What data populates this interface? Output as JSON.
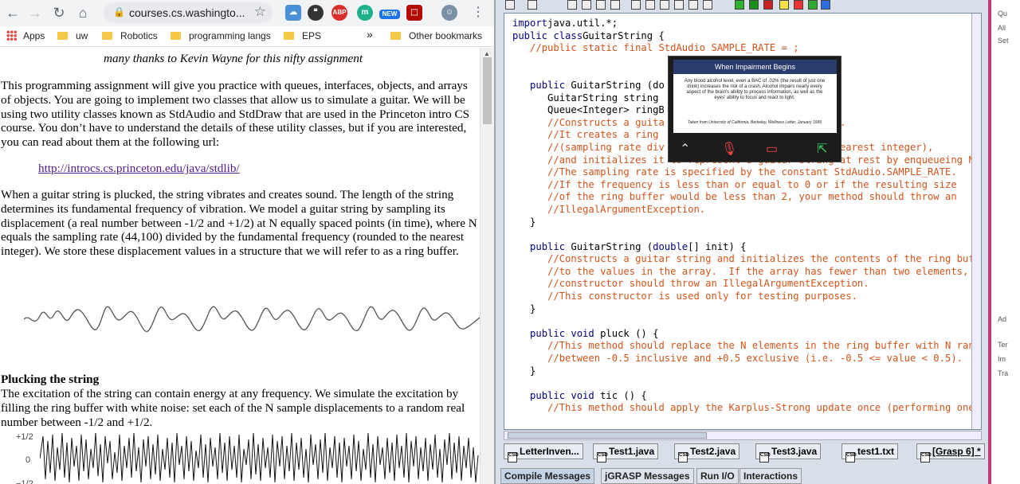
{
  "browser": {
    "url": "courses.cs.washingto...",
    "bookmarks": [
      "Apps",
      "uw",
      "Robotics",
      "programming langs",
      "EPS"
    ],
    "bookmarks_more": "»",
    "other_bookmarks": "Other bookmarks",
    "extensions": [
      "ABP",
      "m",
      "NEW"
    ]
  },
  "page": {
    "thanks": "many thanks to Kevin Wayne for this nifty assignment",
    "intro": "This programming assignment will give you practice with queues, interfaces, objects, and arrays of objects.  You are going to implement two classes that allow us to simulate a guitar. We will be using two utility classes known as StdAudio and StdDraw that are used in the Princeton intro CS course.  You don’t have to understand the details of these utility classes, but if you are interested, you can read about them at the following url:",
    "link": "http://introcs.cs.princeton.edu/java/stdlib/",
    "pluck_para": "When a guitar string is plucked, the string vibrates and creates sound. The length of the string determines its fundamental frequency of vibration. We model a guitar string by sampling its displacement (a real number between -1/2 and +1/2) at N equally spaced points (in time), where N equals the sampling rate (44,100) divided by the fundamental frequency (rounded to the nearest integer).  We store these displacement values in a structure that we will refer to as a ring buffer.",
    "heading": "Plucking the string",
    "excite_para": "The excitation of the string can contain energy at any frequency. We simulate the excitation by filling the ring buffer with white noise: set each of the N sample displacements to a random real number between -1/2 and +1/2.",
    "y_top": "+1/2",
    "y_mid": "0",
    "y_bot": "−1/2"
  },
  "editor": {
    "lines": [
      [
        [
          "kw",
          "import"
        ],
        [
          "",
          "java.util.*;"
        ]
      ],
      [
        [
          "kw",
          "public class"
        ],
        [
          "",
          "GuitarString {"
        ]
      ],
      [
        [
          "",
          "   "
        ],
        [
          "cm",
          "//public static final StdAudio SAMPLE_RATE = ;"
        ]
      ],
      [],
      [],
      [
        [
          "",
          "   "
        ],
        [
          "kw",
          "public"
        ],
        [
          "",
          " GuitarString (do"
        ]
      ],
      [
        [
          "",
          "      GuitarString string"
        ]
      ],
      [
        [
          "",
          "      Queue<Integer> ringB"
        ]
      ],
      [
        [
          "",
          "      "
        ],
        [
          "cm",
          "//Constructs a guita                             y."
        ]
      ],
      [
        [
          "",
          "      "
        ],
        [
          "cm",
          "//It creates a ring                              N"
        ]
      ],
      [
        [
          "",
          "      "
        ],
        [
          "cm",
          "//(sampling rate div                         the nearest integer),"
        ]
      ],
      [
        [
          "",
          "      "
        ],
        [
          "cm",
          "//and initializes it to represent a guitar string at rest by enqueueing N z"
        ]
      ],
      [
        [
          "",
          "      "
        ],
        [
          "cm",
          "//The sampling rate is specified by the constant StdAudio.SAMPLE_RATE."
        ]
      ],
      [
        [
          "",
          "      "
        ],
        [
          "cm",
          "//If the frequency is less than or equal to 0 or if the resulting size"
        ]
      ],
      [
        [
          "",
          "      "
        ],
        [
          "cm",
          "//of the ring buffer would be less than 2, your method should throw an"
        ]
      ],
      [
        [
          "",
          "      "
        ],
        [
          "cm",
          "//IllegalArgumentException."
        ]
      ],
      [
        [
          "",
          "   }"
        ]
      ],
      [],
      [
        [
          "",
          "   "
        ],
        [
          "kw",
          "public"
        ],
        [
          "",
          " GuitarString ("
        ],
        [
          "kw",
          "double"
        ],
        [
          "",
          "[] init) {"
        ]
      ],
      [
        [
          "",
          "      "
        ],
        [
          "cm",
          "//Constructs a guitar string and initializes the contents of the ring buffe"
        ]
      ],
      [
        [
          "",
          "      "
        ],
        [
          "cm",
          "//to the values in the array.  If the array has fewer than two elements, yo"
        ]
      ],
      [
        [
          "",
          "      "
        ],
        [
          "cm",
          "//constructor should throw an IllegalArgumentException."
        ]
      ],
      [
        [
          "",
          "      "
        ],
        [
          "cm",
          "//This constructor is used only for testing purposes."
        ]
      ],
      [
        [
          "",
          "   }"
        ]
      ],
      [],
      [
        [
          "",
          "   "
        ],
        [
          "kw",
          "public void"
        ],
        [
          "",
          " pluck () {"
        ]
      ],
      [
        [
          "",
          "      "
        ],
        [
          "cm",
          "//This method should replace the N elements in the ring buffer with N rando"
        ]
      ],
      [
        [
          "",
          "      "
        ],
        [
          "cm",
          "//between -0.5 inclusive and +0.5 exclusive (i.e. -0.5 <= value < 0.5)."
        ]
      ],
      [
        [
          "",
          "   }"
        ]
      ],
      [],
      [
        [
          "",
          "   "
        ],
        [
          "kw",
          "public void"
        ],
        [
          "",
          " tic () {"
        ]
      ],
      [
        [
          "",
          "      "
        ],
        [
          "cm",
          "//This method should apply the Karplus-Strong update once (performing one s"
        ]
      ]
    ],
    "popup": {
      "title": "When Impairment Begins",
      "body": "Any blood alcohol level, even a BAC of .02% (the result of just one drink) increases the risk of a crash.  Alcohol impairs nearly every aspect of the brain's ability to process information, as well as the eyes' ability to focus and react to light.",
      "caption": "Taken from University of California, Berkeley, Wellness Letter, January 1999"
    }
  },
  "file_tabs": [
    "LetterInven...",
    "Test1.java",
    "Test2.java",
    "Test3.java",
    "test1.txt",
    "[Grasp 6] *"
  ],
  "message_tabs": [
    "Compile Messages",
    "jGRASP Messages",
    "Run I/O",
    "Interactions"
  ],
  "strip": [
    "Qu",
    "All",
    "Set",
    "Ad",
    "Ter",
    "Im",
    "Tra"
  ]
}
